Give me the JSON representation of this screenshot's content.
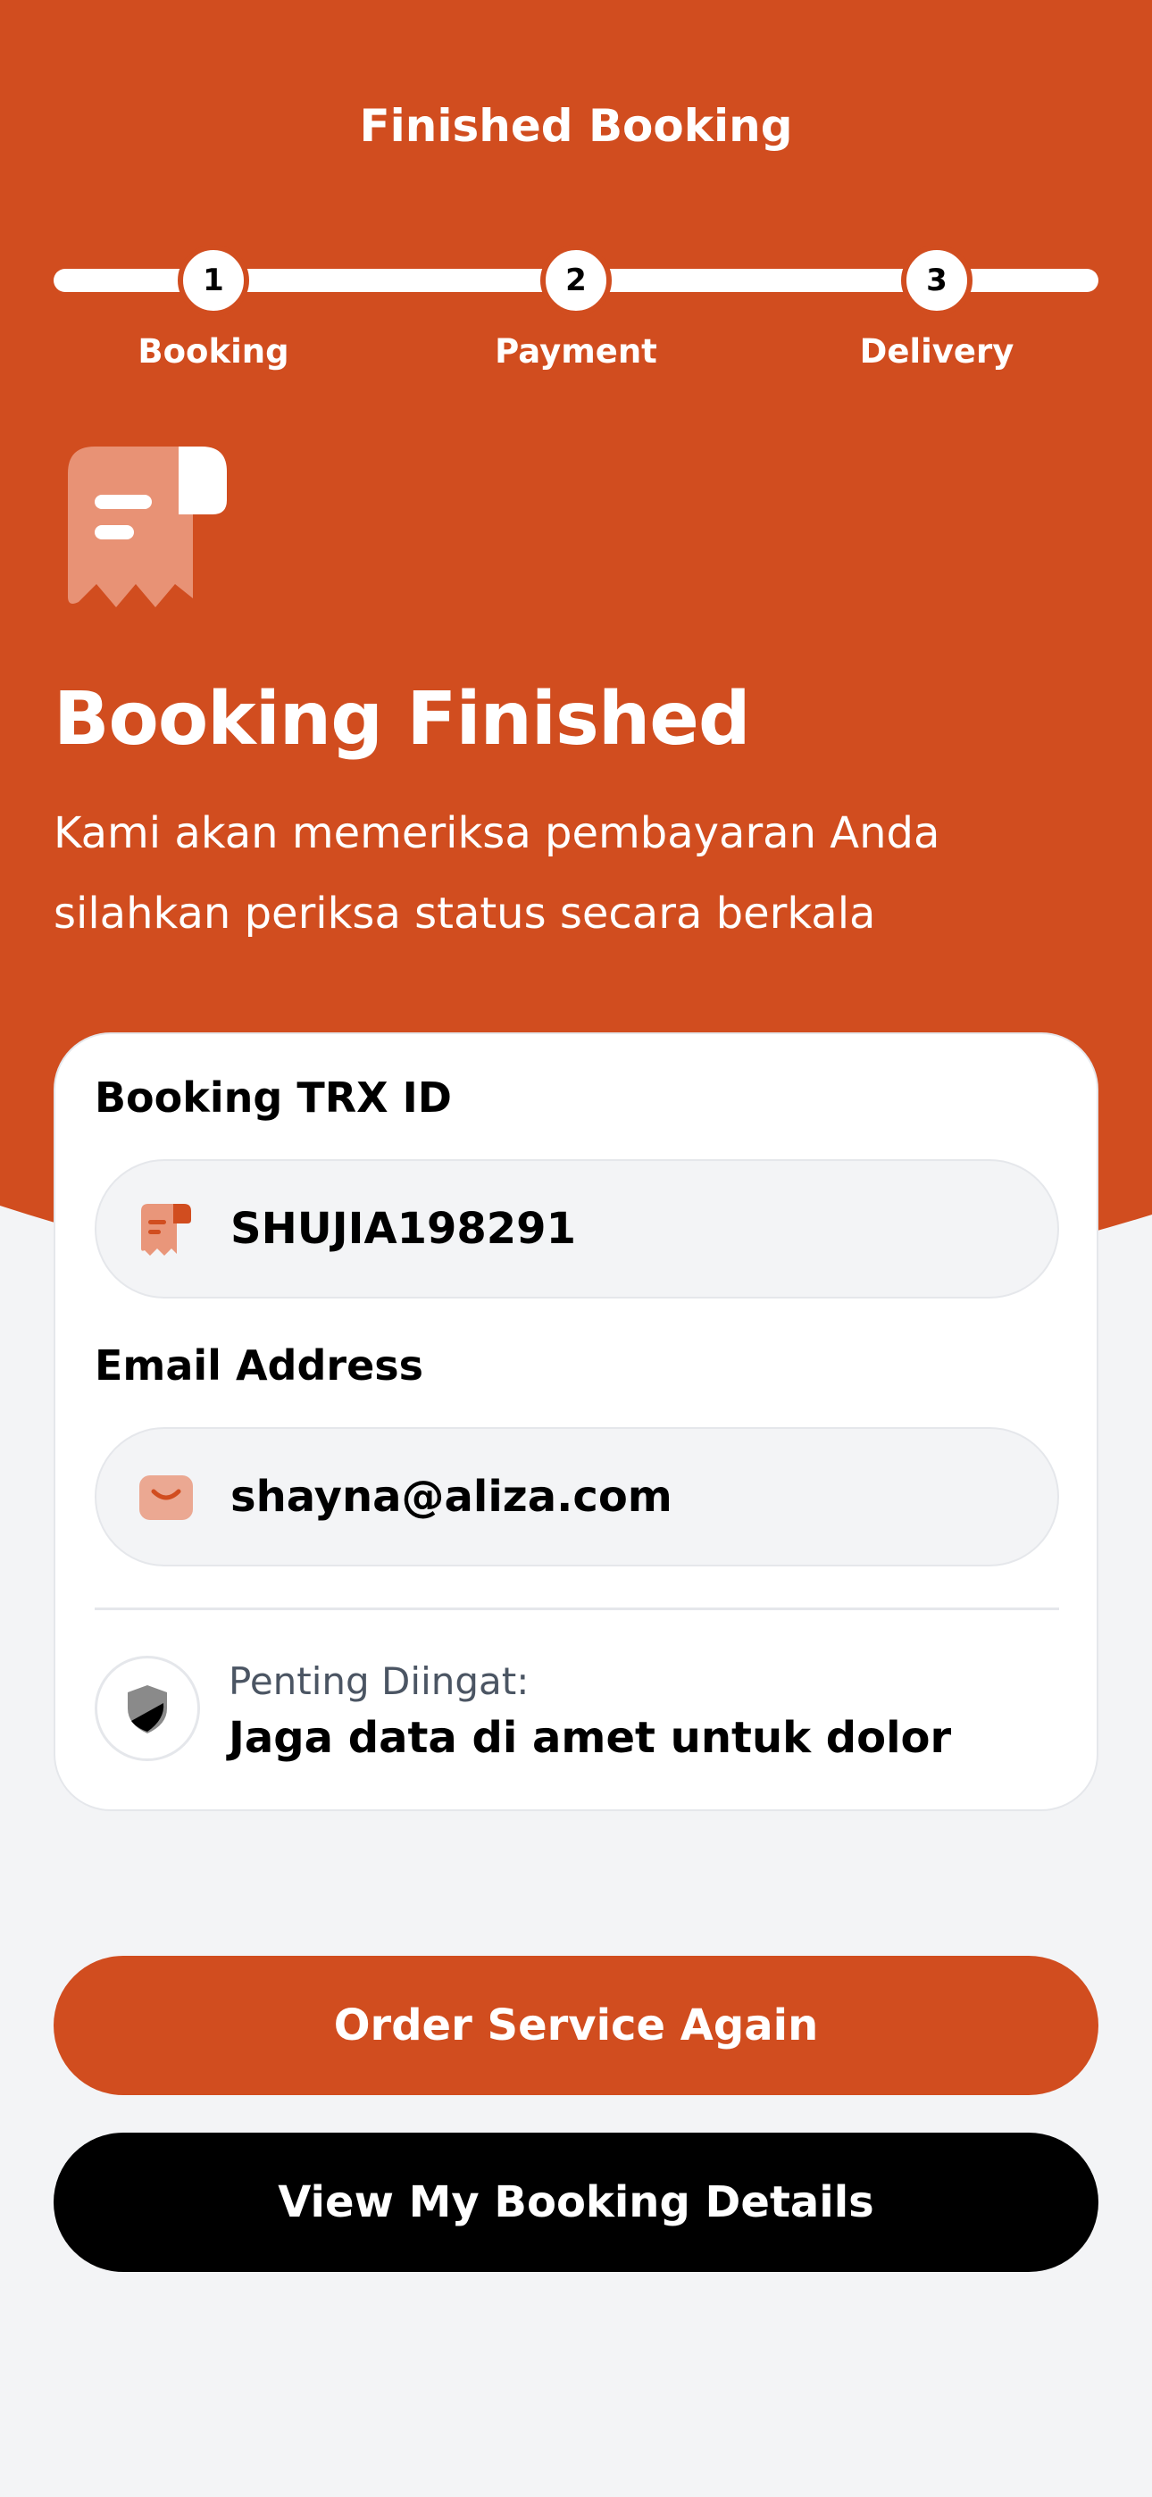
{
  "colors": {
    "accent": "#D14D1F",
    "background": "#F3F4F6",
    "card": "#FFFFFF",
    "dark_button": "#000000"
  },
  "header": {
    "title": "Finished Booking"
  },
  "stepper": {
    "steps": [
      {
        "number": "1",
        "label": "Booking"
      },
      {
        "number": "2",
        "label": "Payment"
      },
      {
        "number": "3",
        "label": "Delivery"
      }
    ]
  },
  "hero": {
    "icon": "receipt-icon",
    "title": "Booking Finished",
    "description": "Kami akan memeriksa pembayaran Anda silahkan periksa status secara berkala"
  },
  "card": {
    "trx": {
      "label": "Booking TRX ID",
      "icon": "receipt-icon",
      "value": "SHUJIA198291"
    },
    "email": {
      "label": "Email Address",
      "icon": "mail-icon",
      "value": "shayna@aliza.com"
    },
    "note": {
      "icon": "shield-icon",
      "title": "Penting Diingat:",
      "text": "Jaga data di amet untuk dolor"
    }
  },
  "actions": {
    "order_again": "Order Service Again",
    "view_details": "View My Booking Details"
  }
}
